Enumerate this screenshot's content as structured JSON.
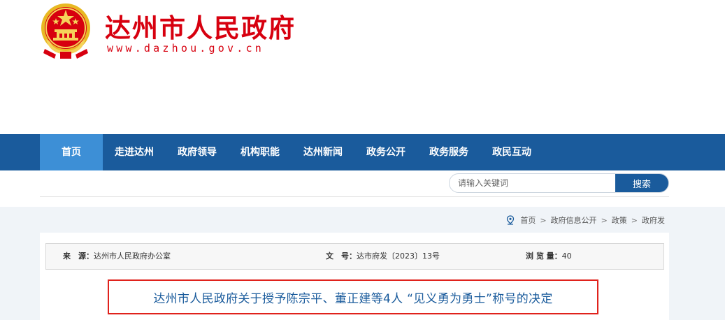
{
  "header": {
    "site_title": "达州市人民政府",
    "site_url": "www.dazhou.gov.cn",
    "emblem_icon": "national-emblem-icon"
  },
  "nav": {
    "items": [
      {
        "label": "首页",
        "active": true
      },
      {
        "label": "走进达州",
        "active": false
      },
      {
        "label": "政府领导",
        "active": false
      },
      {
        "label": "机构职能",
        "active": false
      },
      {
        "label": "达州新闻",
        "active": false
      },
      {
        "label": "政务公开",
        "active": false
      },
      {
        "label": "政务服务",
        "active": false
      },
      {
        "label": "政民互动",
        "active": false
      }
    ]
  },
  "search": {
    "placeholder": "请输入关键词",
    "button_label": "搜索"
  },
  "breadcrumb": {
    "icon": "location-pin-icon",
    "items": [
      "首页",
      "政府信息公开",
      "政策",
      "政府发"
    ],
    "separator": ">"
  },
  "info": {
    "source_label": "来　源：",
    "source_value": "达州市人民政府办公室",
    "doc_no_label": "文　号：",
    "doc_no_value": "达市府发〔2023〕13号",
    "views_label": "浏 览 量：",
    "views_value": "40"
  },
  "article": {
    "title": "达州市人民政府关于授予陈宗平、董正建等4人 “见义勇为勇士”称号的决定"
  },
  "colors": {
    "brand_red": "#d7000f",
    "nav_blue": "#1a5b9c",
    "nav_active": "#3d8fd6",
    "highlight_red": "#e0221c"
  }
}
